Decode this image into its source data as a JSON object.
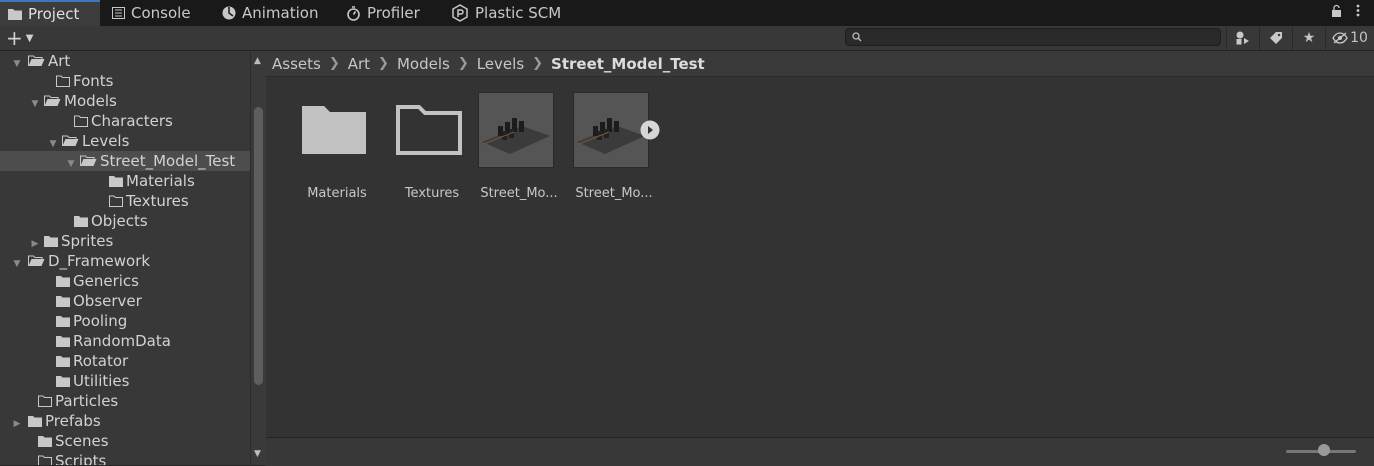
{
  "tabs": [
    {
      "label": "Project",
      "icon": "folder-icon",
      "active": true
    },
    {
      "label": "Console",
      "icon": "console-icon"
    },
    {
      "label": "Animation",
      "icon": "animation-icon"
    },
    {
      "label": "Profiler",
      "icon": "profiler-icon"
    },
    {
      "label": "Plastic SCM",
      "icon": "plastic-scm-icon"
    }
  ],
  "toolbar": {
    "add_label": "+",
    "search_placeholder": "",
    "hidden_count": "10"
  },
  "tree": [
    {
      "label": "Art"
    },
    {
      "label": "Fonts"
    },
    {
      "label": "Models"
    },
    {
      "label": "Characters"
    },
    {
      "label": "Levels"
    },
    {
      "label": "Street_Model_Test"
    },
    {
      "label": "Materials"
    },
    {
      "label": "Textures"
    },
    {
      "label": "Objects"
    },
    {
      "label": "Sprites"
    },
    {
      "label": "D_Framework"
    },
    {
      "label": "Generics"
    },
    {
      "label": "Observer"
    },
    {
      "label": "Pooling"
    },
    {
      "label": "RandomData"
    },
    {
      "label": "Rotator"
    },
    {
      "label": "Utilities"
    },
    {
      "label": "Particles"
    },
    {
      "label": "Prefabs"
    },
    {
      "label": "Scenes"
    },
    {
      "label": "Scripts"
    }
  ],
  "breadcrumb": {
    "items": [
      "Assets",
      "Art",
      "Models",
      "Levels"
    ],
    "current": "Street_Model_Test"
  },
  "assets": [
    {
      "label": "Materials",
      "kind": "folder-filled"
    },
    {
      "label": "Textures",
      "kind": "folder-empty"
    },
    {
      "label": "Street_Mo...",
      "kind": "model"
    },
    {
      "label": "Street_Mo...",
      "kind": "model-expandable"
    }
  ]
}
